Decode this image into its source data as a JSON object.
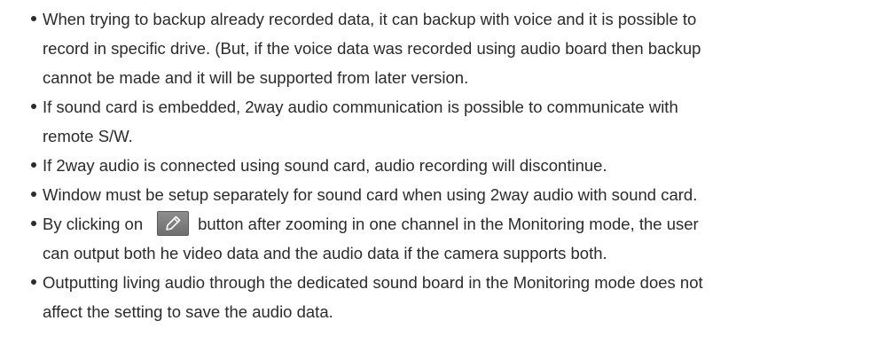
{
  "bullets": [
    {
      "text": "When trying to backup already recorded data, it can backup with voice and it is possible to\nrecord in specific drive. (But, if the voice data was recorded using audio board then backup\ncannot be made and it will be supported from later version."
    },
    {
      "text": "If sound card is embedded, 2way audio communication is possible to communicate with\nremote S/W."
    },
    {
      "text": "If 2way audio is connected using sound card, audio recording will discontinue."
    },
    {
      "text": "Window must be setup separately for sound card when using 2way audio with sound card."
    },
    {
      "text_before": "By clicking on",
      "icon": "audio-output-icon",
      "text_after": "button after zooming in one channel in the Monitoring mode, the user\ncan output both he video data and the audio data if the camera supports both."
    },
    {
      "text": "Outputting living audio through the dedicated sound board in the Monitoring mode does not\naffect the setting to save the audio data."
    }
  ],
  "colors": {
    "text": "#2b2b2b",
    "button_bg": "#7f7f7f"
  }
}
